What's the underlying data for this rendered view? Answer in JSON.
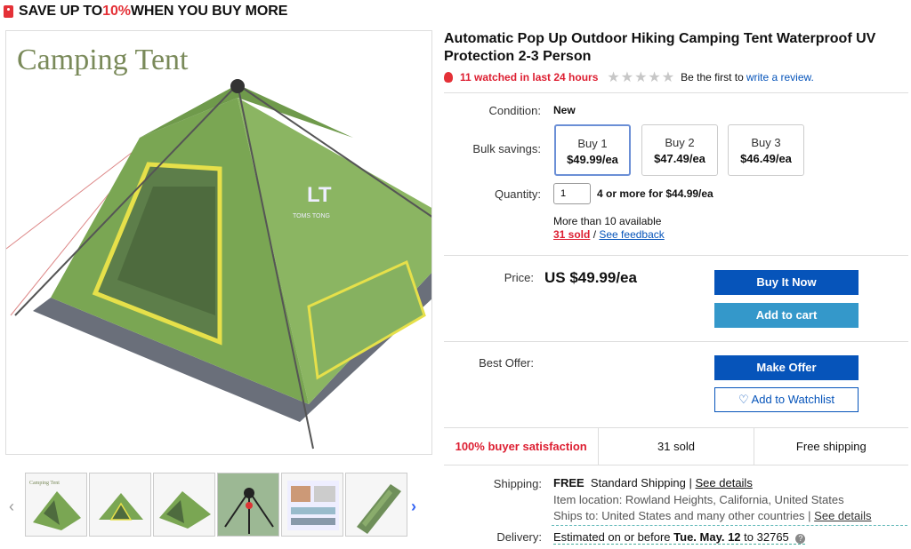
{
  "promo": {
    "prefix": "SAVE UP TO ",
    "pct": "10%",
    "suffix": " WHEN YOU BUY MORE"
  },
  "gallery": {
    "image_title": "Camping Tent",
    "tent_logo": "TOMS TONG",
    "thumbnails": [
      "tent-thumb-1",
      "tent-thumb-2",
      "tent-thumb-3",
      "tent-frame-thumb",
      "tent-accessories-thumb",
      "tent-bag-thumb"
    ]
  },
  "product": {
    "title": "Automatic Pop Up Outdoor Hiking Camping Tent Waterproof UV Protection 2-3 Person",
    "watched": "11 watched in last 24 hours",
    "stars": "★★★★★",
    "review_prefix": "Be the first to",
    "review_link": "write a review."
  },
  "condition": {
    "label": "Condition:",
    "value": "New"
  },
  "bulk": {
    "label": "Bulk savings:",
    "options": [
      {
        "qty": "Buy 1",
        "price": "$49.99/ea"
      },
      {
        "qty": "Buy 2",
        "price": "$47.49/ea"
      },
      {
        "qty": "Buy 3",
        "price": "$46.49/ea"
      }
    ]
  },
  "quantity": {
    "label": "Quantity:",
    "value": "1",
    "offer": "4 or more for $44.99/ea",
    "available": "More than 10 available",
    "sold": "31 sold",
    "separator": " / ",
    "feedback": "See feedback"
  },
  "price": {
    "label": "Price:",
    "value": "US $49.99/ea"
  },
  "buttons": {
    "buy_now": "Buy It Now",
    "add_to_cart": "Add to cart",
    "make_offer": "Make Offer",
    "watchlist": "Add to Watchlist"
  },
  "best_offer": {
    "label": "Best Offer:"
  },
  "stats": {
    "satisfaction": "100% buyer satisfaction",
    "sold": "31 sold",
    "shipping": "Free shipping"
  },
  "shipping": {
    "label": "Shipping:",
    "free": "FREE",
    "method": "Standard Shipping |",
    "details": "See details",
    "location": "Item location: Rowland Heights, California, United States",
    "ships_to": "Ships to: United States and many other countries |",
    "ships_details": "See details"
  },
  "delivery": {
    "label": "Delivery:",
    "prefix": "Estimated on or before",
    "date": "Tue. May. 12",
    "suffix": "to 32765"
  },
  "colors": {
    "accent": "#0654ba",
    "alert": "#dd1e31",
    "tent_green": "#7fa85a"
  }
}
